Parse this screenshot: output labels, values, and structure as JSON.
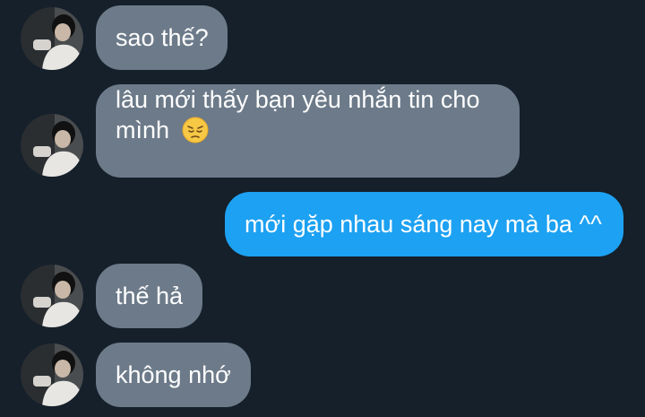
{
  "messages": [
    {
      "id": 1,
      "direction": "received",
      "text": "sao thế?"
    },
    {
      "id": 2,
      "direction": "received",
      "text": "lâu mới thấy bạn yêu nhắn tin cho",
      "text_line2": "mình",
      "emoji": "pensive-face-icon"
    },
    {
      "id": 3,
      "direction": "sent",
      "text": "mới gặp nhau sáng nay mà ba ^^"
    },
    {
      "id": 4,
      "direction": "received",
      "text": "thế hả"
    },
    {
      "id": 5,
      "direction": "received",
      "text": "không nhớ"
    }
  ],
  "colors": {
    "background": "#15202b",
    "received_bubble": "#6c7a89",
    "sent_bubble": "#1da1f2",
    "text": "#ffffff"
  }
}
